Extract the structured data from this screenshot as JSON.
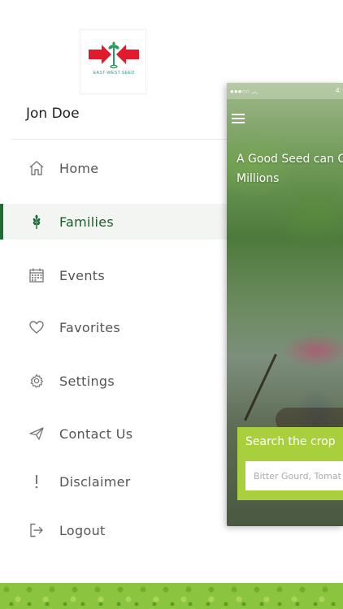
{
  "brand": {
    "logo_text": "EAST-WEST SEED",
    "logo_colors": {
      "arrow_red": "#e11b2c",
      "plant_green": "#2a9a5a"
    }
  },
  "user": {
    "name": "Jon Doe"
  },
  "menu": {
    "items": [
      {
        "id": "home",
        "label": "Home",
        "icon": "home-icon"
      },
      {
        "id": "families",
        "label": "Families",
        "icon": "wheat-icon",
        "active": true
      },
      {
        "id": "events",
        "label": "Events",
        "icon": "calendar-icon"
      },
      {
        "id": "favorites",
        "label": "Favorites",
        "icon": "heart-icon"
      },
      {
        "id": "settings",
        "label": "Settings",
        "icon": "gear-icon"
      },
      {
        "id": "contact",
        "label": "Contact Us",
        "icon": "paper-plane-icon"
      },
      {
        "id": "disclaimer",
        "label": "Disclaimer",
        "icon": "exclamation-icon"
      },
      {
        "id": "logout",
        "label": "Logout",
        "icon": "logout-icon"
      }
    ]
  },
  "preview": {
    "status_time": "4:",
    "tagline": "A Good Seed can C of Millions",
    "search_title": "Search the crop",
    "search_placeholder": "Bitter Gourd, Tomat"
  },
  "colors": {
    "accent_green": "#1f6b33",
    "active_bg": "#f2f5f1",
    "search_card": "#a9cf3c",
    "footer_green": "#8bc53f"
  }
}
